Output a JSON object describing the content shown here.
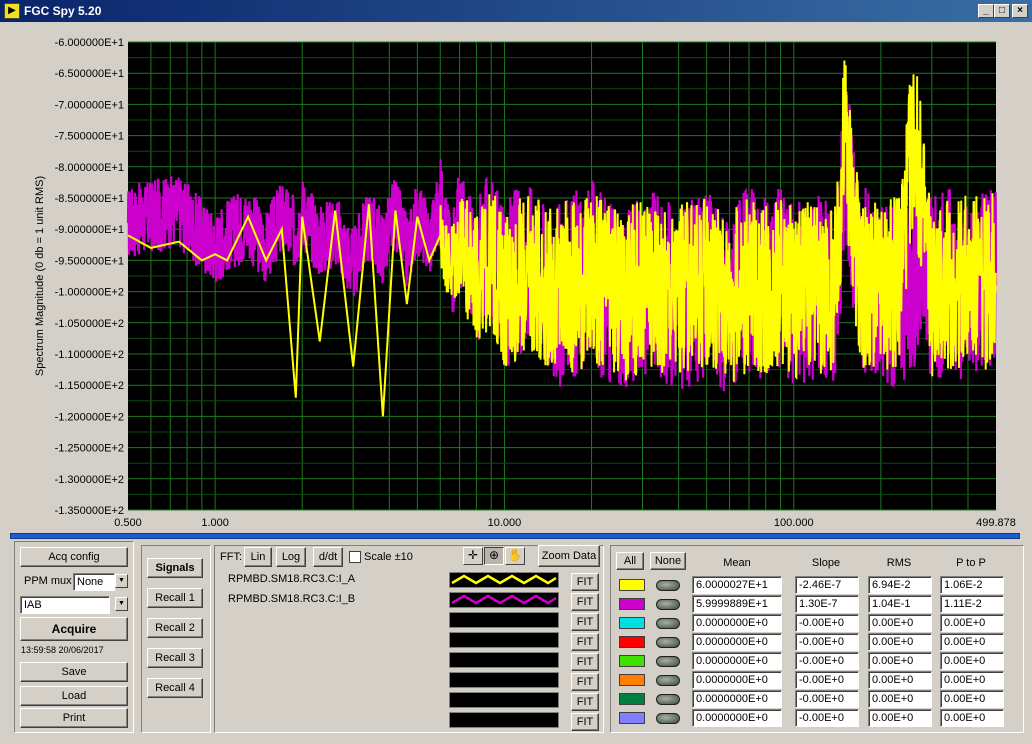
{
  "window": {
    "title": "FGC Spy 5.20",
    "minimize": "_",
    "maximize": "□",
    "close": "×"
  },
  "chart_data": {
    "type": "line",
    "ylabel": "Spectrum Magnitude (0 db = 1 unit RMS)",
    "xlabel": "",
    "x_scale": "log",
    "xlim": [
      0.5,
      499.878
    ],
    "ylim": [
      -135,
      -60
    ],
    "x_tick_labels": [
      "0.500",
      "1.000",
      "10.000",
      "100.000",
      "499.878"
    ],
    "y_tick_labels": [
      "-6.000000E+1",
      "-6.500000E+1",
      "-7.000000E+1",
      "-7.500000E+1",
      "-8.000000E+1",
      "-8.500000E+1",
      "-9.000000E+1",
      "-9.500000E+1",
      "-1.000000E+2",
      "-1.050000E+2",
      "-1.100000E+2",
      "-1.150000E+2",
      "-1.200000E+2",
      "-1.250000E+2",
      "-1.300000E+2",
      "-1.350000E+2"
    ],
    "background": "#000000",
    "grid": true,
    "grid_color": "#1f7a1f",
    "series": [
      {
        "color": "#cc00cc",
        "x": [
          0.5,
          0.6,
          0.75,
          0.9,
          1.0,
          1.1,
          1.3,
          1.5,
          1.7,
          1.9,
          2.0,
          2.3,
          2.6,
          3.0,
          3.4,
          3.8,
          4.2,
          4.6,
          5.0,
          5.5,
          6.0,
          6.5,
          7.0,
          8.0,
          9.0,
          10,
          12,
          15,
          20,
          25,
          30,
          40,
          50,
          60,
          70,
          80,
          90,
          100,
          120,
          140,
          150,
          170,
          200,
          230,
          260,
          300,
          350,
          400,
          450,
          499.878
        ],
        "y": [
          -89,
          -88,
          -87,
          -91,
          -93,
          -91,
          -89,
          -93,
          -88,
          -91,
          -87,
          -92,
          -90,
          -96,
          -89,
          -93,
          -87,
          -94,
          -88,
          -92,
          -86,
          -95,
          -90,
          -97,
          -92,
          -99,
          -95,
          -101,
          -97,
          -102,
          -98,
          -101,
          -99,
          -102,
          -98,
          -100,
          -97,
          -101,
          -99,
          -100,
          -78,
          -98,
          -99,
          -101,
          -97,
          -100,
          -98,
          -101,
          -97,
          -99
        ],
        "envelope": [
          6,
          6,
          6,
          6,
          6,
          6,
          6,
          6,
          6,
          6,
          6,
          6,
          6,
          6,
          6,
          6,
          6,
          6,
          6,
          6,
          8,
          10,
          10,
          12,
          12,
          14,
          14,
          15,
          15,
          15,
          15,
          15,
          15,
          15,
          15,
          15,
          15,
          15,
          15,
          15,
          15,
          15,
          15,
          15,
          15,
          15,
          15,
          15,
          15,
          15
        ]
      },
      {
        "color": "#ffff00",
        "x": [
          0.5,
          0.6,
          0.75,
          0.9,
          1.0,
          1.1,
          1.3,
          1.5,
          1.7,
          1.9,
          2.0,
          2.3,
          2.6,
          3.0,
          3.4,
          3.8,
          4.2,
          4.6,
          5.0,
          5.5,
          6.0,
          6.5,
          7.0,
          8.0,
          9.0,
          10,
          12,
          15,
          20,
          25,
          30,
          40,
          50,
          60,
          70,
          80,
          90,
          100,
          120,
          140,
          150,
          170,
          200,
          230,
          260,
          300,
          350,
          400,
          450,
          499.878
        ],
        "y": [
          -91,
          -93,
          -92,
          -95,
          -94,
          -95,
          -88,
          -95,
          -90,
          -117,
          -88,
          -108,
          -87,
          -112,
          -86,
          -120,
          -87,
          -102,
          -88,
          -95,
          -91,
          -96,
          -93,
          -98,
          -95,
          -100,
          -97,
          -100,
          -98,
          -101,
          -99,
          -100,
          -98,
          -101,
          -99,
          -100,
          -98,
          -100,
          -99,
          -100,
          -73,
          -99,
          -100,
          -98,
          -74,
          -100,
          -99,
          -98,
          -99,
          -97
        ],
        "envelope": [
          0,
          0,
          0,
          0,
          0,
          0,
          0,
          0,
          0,
          0,
          0,
          0,
          0,
          0,
          0,
          0,
          0,
          0,
          0,
          0,
          6,
          8,
          10,
          11,
          12,
          13,
          13,
          14,
          14,
          14,
          14,
          14,
          14,
          14,
          14,
          14,
          14,
          14,
          14,
          14,
          14,
          14,
          14,
          14,
          14,
          14,
          14,
          14,
          14,
          14
        ]
      }
    ]
  },
  "controls": {
    "acq_config": "Acq config",
    "ppm_mux_label": "PPM mux",
    "ppm_mux_value": "None",
    "signal_select_value": "IAB",
    "acquire": "Acquire",
    "timestamp": "13:59:58 20/06/2017",
    "save": "Save",
    "load": "Load",
    "print": "Print"
  },
  "recall": {
    "signals": "Signals",
    "recall1": "Recall 1",
    "recall2": "Recall 2",
    "recall3": "Recall 3",
    "recall4": "Recall 4"
  },
  "fft": {
    "label": "FFT:",
    "lin": "Lin",
    "log": "Log",
    "ddt": "d/dt",
    "scale_label": "Scale ±10",
    "zoom_data": "Zoom Data",
    "fit": "FIT"
  },
  "signals": [
    {
      "name": "RPMBD.SM18.RC3.C:I_A",
      "color": "#ffff00"
    },
    {
      "name": "RPMBD.SM18.RC3.C:I_B",
      "color": "#cc00cc"
    },
    {
      "name": "",
      "color": ""
    },
    {
      "name": "",
      "color": ""
    },
    {
      "name": "",
      "color": ""
    },
    {
      "name": "",
      "color": ""
    },
    {
      "name": "",
      "color": ""
    },
    {
      "name": "",
      "color": ""
    }
  ],
  "stats": {
    "all": "All",
    "none": "None",
    "headers": [
      "Mean",
      "Slope",
      "RMS",
      "P to P"
    ],
    "rows": [
      {
        "color": "#ffff00",
        "mean": "6.0000027E+1",
        "slope": "-2.46E-7",
        "rms": "6.94E-2",
        "ptop": "1.06E-2"
      },
      {
        "color": "#cc00cc",
        "mean": "5.9999889E+1",
        "slope": "1.30E-7",
        "rms": "1.04E-1",
        "ptop": "1.11E-2"
      },
      {
        "color": "#00e0e0",
        "mean": "0.0000000E+0",
        "slope": "-0.00E+0",
        "rms": "0.00E+0",
        "ptop": "0.00E+0"
      },
      {
        "color": "#ff0000",
        "mean": "0.0000000E+0",
        "slope": "-0.00E+0",
        "rms": "0.00E+0",
        "ptop": "0.00E+0"
      },
      {
        "color": "#40e000",
        "mean": "0.0000000E+0",
        "slope": "-0.00E+0",
        "rms": "0.00E+0",
        "ptop": "0.00E+0"
      },
      {
        "color": "#ff8000",
        "mean": "0.0000000E+0",
        "slope": "-0.00E+0",
        "rms": "0.00E+0",
        "ptop": "0.00E+0"
      },
      {
        "color": "#008040",
        "mean": "0.0000000E+0",
        "slope": "-0.00E+0",
        "rms": "0.00E+0",
        "ptop": "0.00E+0"
      },
      {
        "color": "#8080ff",
        "mean": "0.0000000E+0",
        "slope": "-0.00E+0",
        "rms": "0.00E+0",
        "ptop": "0.00E+0"
      }
    ]
  }
}
